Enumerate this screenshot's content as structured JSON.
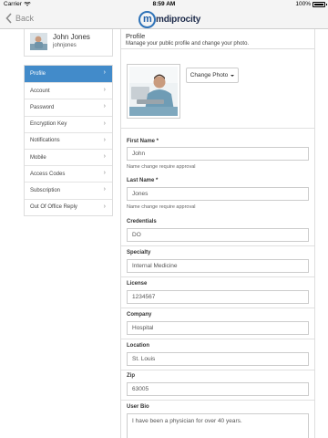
{
  "status_bar": {
    "carrier": "Carrier",
    "time": "8:59 AM",
    "battery": "100%"
  },
  "nav": {
    "back_label": "Back",
    "logo_text": "mdiprocity"
  },
  "user": {
    "name": "John Jones",
    "username": "johnjones"
  },
  "menu": {
    "items": [
      {
        "label": "Profile",
        "active": true
      },
      {
        "label": "Account",
        "active": false
      },
      {
        "label": "Password",
        "active": false
      },
      {
        "label": "Encryption Key",
        "active": false
      },
      {
        "label": "Notifications",
        "active": false
      },
      {
        "label": "Mobile",
        "active": false
      },
      {
        "label": "Access Codes",
        "active": false
      },
      {
        "label": "Subscription",
        "active": false
      },
      {
        "label": "Out Of Office Reply",
        "active": false
      }
    ]
  },
  "profile": {
    "title": "Profile",
    "subtitle": "Manage your public profile and change your photo.",
    "change_photo_label": "Change Photo",
    "fields": {
      "first_name": {
        "label": "First Name *",
        "value": "John",
        "help": "Name change require approval"
      },
      "last_name": {
        "label": "Last Name *",
        "value": "Jones",
        "help": "Name change require approval"
      },
      "credentials": {
        "label": "Credentials",
        "value": "DO"
      },
      "specialty": {
        "label": "Specialty",
        "value": "Internal Medicine"
      },
      "license": {
        "label": "License",
        "value": "1234567"
      },
      "company": {
        "label": "Company",
        "value": "Hospital"
      },
      "location": {
        "label": "Location",
        "value": "St. Louis"
      },
      "zip": {
        "label": "Zip",
        "value": "63005"
      },
      "user_bio": {
        "label": "User Bio",
        "value": "I have been a physician for over 40 years."
      }
    }
  },
  "colors": {
    "accent": "#428bca",
    "nav_bg": "#f4f4f4",
    "logo_blue": "#2f73b8"
  }
}
